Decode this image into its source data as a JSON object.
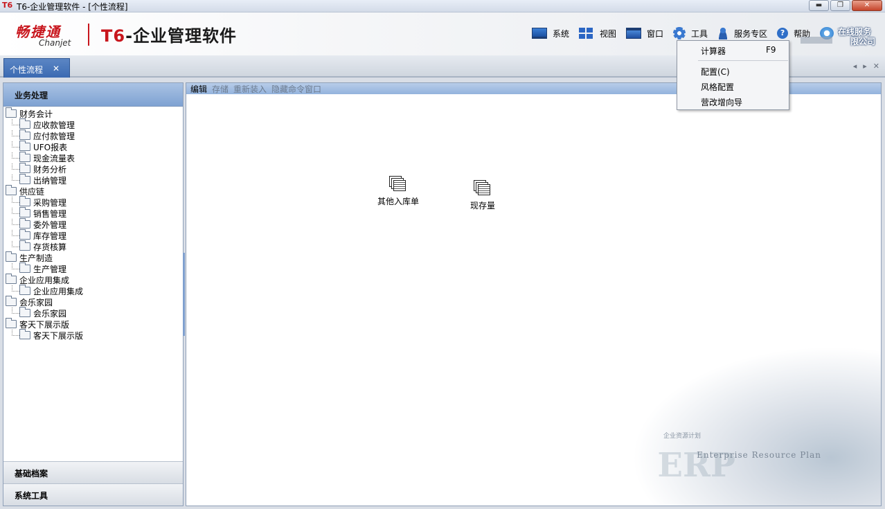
{
  "window": {
    "logo": "T6",
    "title": "T6-企业管理软件 - [个性流程]",
    "buttons": {
      "minimize": "▬",
      "restore": "❐",
      "close": "✕"
    }
  },
  "brand": {
    "name_cn": "畅捷通",
    "name_en": "Chanjet",
    "product_t": "T6",
    "product_rest": "-企业管理软件",
    "accent": "#c8161d"
  },
  "menubar": {
    "items": [
      {
        "label": "系统",
        "icon": "monitor-icon"
      },
      {
        "label": "视图",
        "icon": "grid-icon"
      },
      {
        "label": "窗口",
        "icon": "window-icon"
      },
      {
        "label": "工具",
        "icon": "gear-icon"
      },
      {
        "label": "服务专区",
        "icon": "user-icon"
      },
      {
        "label": "帮助",
        "icon": "help-icon"
      }
    ],
    "online_line1": "在线服务",
    "online_line2": "限公司",
    "help_glyph": "?"
  },
  "tabs": {
    "active": {
      "label": "个性流程",
      "close": "✕"
    },
    "nav": {
      "prev": "◂",
      "next": "▸",
      "close": "✕"
    }
  },
  "leftpanel": {
    "header": "业务处理",
    "tree": [
      {
        "label": "财务会计",
        "level": 0
      },
      {
        "label": "应收款管理",
        "level": 1
      },
      {
        "label": "应付款管理",
        "level": 1
      },
      {
        "label": "UFO报表",
        "level": 1
      },
      {
        "label": "现金流量表",
        "level": 1
      },
      {
        "label": "财务分析",
        "level": 1
      },
      {
        "label": "出纳管理",
        "level": 1
      },
      {
        "label": "供应链",
        "level": 0
      },
      {
        "label": "采购管理",
        "level": 1
      },
      {
        "label": "销售管理",
        "level": 1
      },
      {
        "label": "委外管理",
        "level": 1
      },
      {
        "label": "库存管理",
        "level": 1
      },
      {
        "label": "存货核算",
        "level": 1
      },
      {
        "label": "生产制造",
        "level": 0
      },
      {
        "label": "生产管理",
        "level": 1
      },
      {
        "label": "企业应用集成",
        "level": 0
      },
      {
        "label": "企业应用集成",
        "level": 1
      },
      {
        "label": "会乐家园",
        "level": 0
      },
      {
        "label": "会乐家园",
        "level": 1
      },
      {
        "label": "客天下展示版",
        "level": 0
      },
      {
        "label": "客天下展示版",
        "level": 1
      }
    ],
    "footer1": "基础档案",
    "footer2": "系统工具"
  },
  "main": {
    "toolbar": [
      {
        "label": "编辑",
        "active": true
      },
      {
        "label": "存储",
        "active": false
      },
      {
        "label": "重新装入",
        "active": false
      },
      {
        "label": "隐藏命令窗口",
        "active": false
      }
    ],
    "nodes": [
      {
        "label": "其他入库单"
      },
      {
        "label": "现存量"
      }
    ],
    "watermark": {
      "cn": "企业资源计划",
      "en": "Enterprise Resource Plan",
      "big": "ERP"
    }
  },
  "dropdown": {
    "items": [
      {
        "label": "计算器",
        "shortcut": "F9"
      },
      {
        "label": "配置(C)",
        "shortcut": ""
      },
      {
        "label": "风格配置",
        "shortcut": ""
      },
      {
        "label": "营改增向导",
        "shortcut": ""
      }
    ]
  }
}
